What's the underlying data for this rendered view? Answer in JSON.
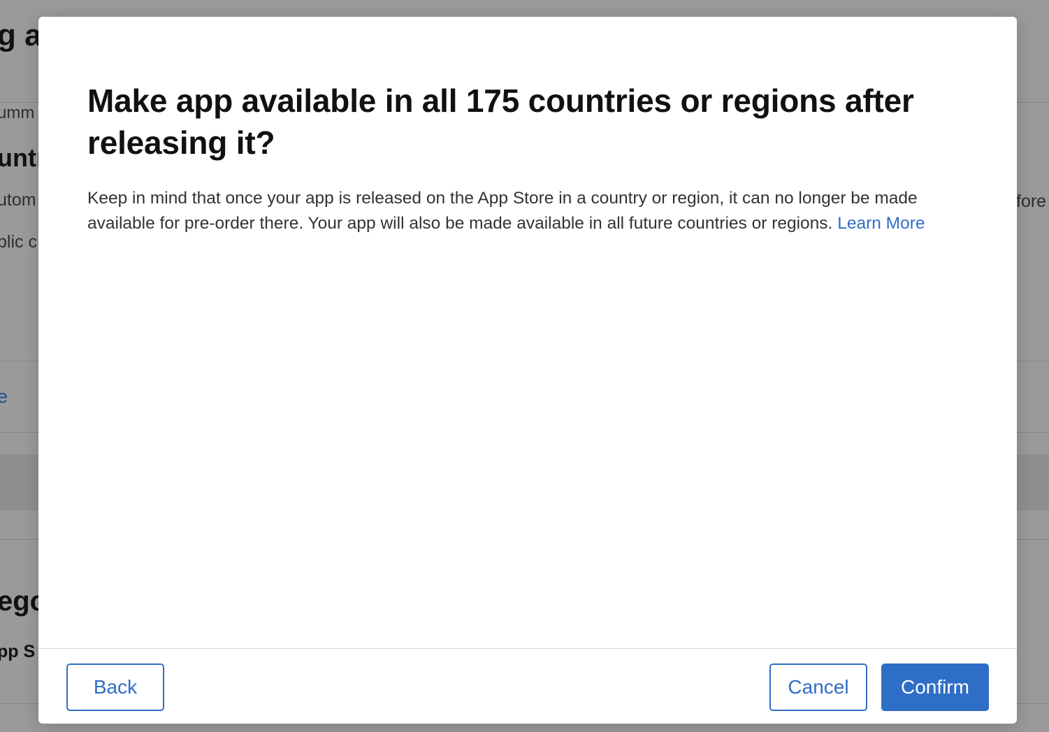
{
  "background": {
    "title_fragment": "g ar",
    "subtitle_fragment": "umm",
    "heading_fragment": "untr",
    "text_fragment_1": "utom",
    "text_fragment_2": "blic c",
    "right_fragment": "fore",
    "link_fragment": "e",
    "heading2_fragment": "ego",
    "bold_fragment": "pp S"
  },
  "modal": {
    "title": "Make app available in all 175 countries or regions after releasing it?",
    "body_text": "Keep in mind that once your app is released on the App Store in a country or region, it can no longer be made available for pre-order there. Your app will also be made available in all future countries or regions.",
    "learn_more_label": "Learn More",
    "back_label": "Back",
    "cancel_label": "Cancel",
    "confirm_label": "Confirm"
  },
  "colors": {
    "accent": "#2f6ec6",
    "overlay": "#9a9a9a"
  }
}
